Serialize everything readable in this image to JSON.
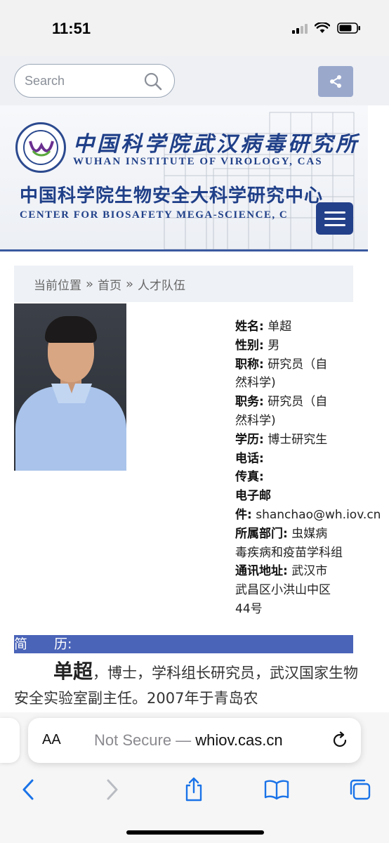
{
  "status_bar": {
    "time": "11:51"
  },
  "header": {
    "search_placeholder": "Search",
    "wiv_chinese": "中国科学院武汉病毒研究所",
    "wiv_english": "WUHAN INSTITUTE OF VIROLOGY, CAS",
    "center_chinese": "中国科学院生物安全大科学研究中心",
    "center_english": "CENTER FOR BIOSAFETY MEGA-SCIENCE, C"
  },
  "breadcrumb": {
    "label": "当前位置",
    "items": [
      "首页",
      "人才队伍"
    ],
    "separator": "»"
  },
  "profile": {
    "name_label": "姓名:",
    "name": "单超",
    "gender_label": "性别:",
    "gender": "男",
    "title_label": "职称:",
    "title_line1": "研究员（自",
    "title_line2": "然科学)",
    "position_label": "职务:",
    "position_line1": "研究员（自",
    "position_line2": "然科学)",
    "education_label": "学历:",
    "education": "博士研究生",
    "phone_label": "电话:",
    "fax_label": "传真:",
    "email_label_line1": "电子邮",
    "email_label_line2": "件:",
    "email": "shanchao@wh.iov.cn",
    "department_label": "所属部门:",
    "department_line1": "虫媒病",
    "department_line2": "毒疾病和疫苗学科组",
    "address_label": "通讯地址:",
    "address_line1": "武汉市",
    "address_line2": "武昌区小洪山中区",
    "address_line3": "44号"
  },
  "section": {
    "title": "简　　历:",
    "bio_name": "单超",
    "bio_text": "，博士，学科组长研究员，武汉国家生物安全实验室副主任。2007年于青岛农"
  },
  "browser": {
    "aa_label": "AA",
    "url_prefix": "Not Secure — ",
    "url_domain": "whiov.cas.cn"
  },
  "colors": {
    "accent": "#4a64b8",
    "menu_button": "#23408a",
    "share_button": "#9aa8cc",
    "ios_blue": "#1a73e8"
  }
}
